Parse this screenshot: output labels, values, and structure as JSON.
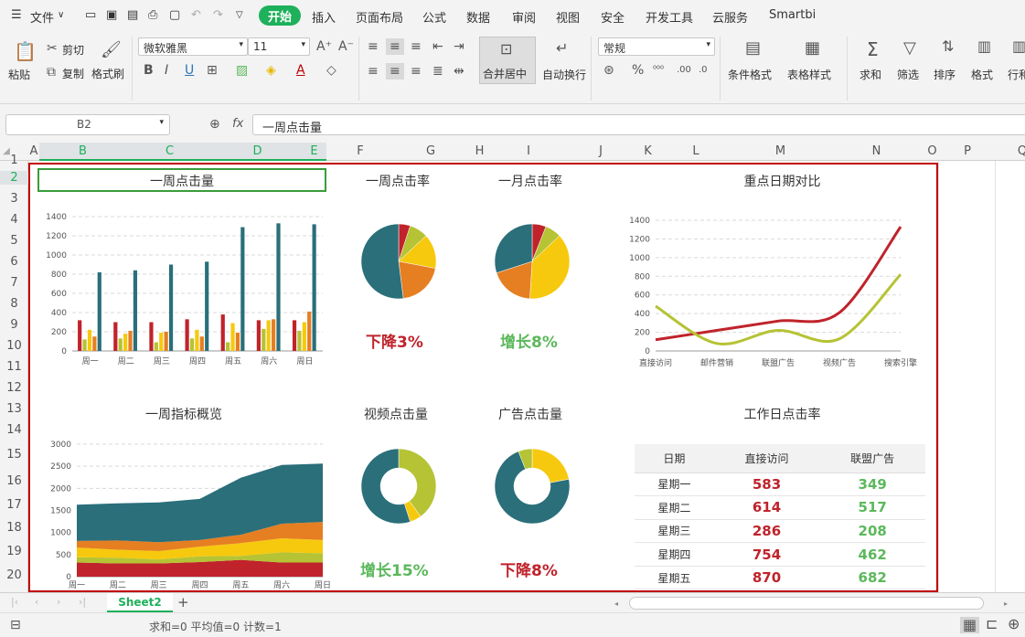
{
  "menu": {
    "file": "文件",
    "tabs": [
      "开始",
      "插入",
      "页面布局",
      "公式",
      "数据",
      "审阅",
      "视图",
      "安全",
      "开发工具",
      "云服务",
      "Smartbi"
    ]
  },
  "ribbon": {
    "paste": "粘贴",
    "cut": "剪切",
    "copy": "复制",
    "format_painter": "格式刷",
    "font_name": "微软雅黑",
    "font_size": "11",
    "merge_center": "合并居中",
    "wrap_text": "自动换行",
    "number_format": "常规",
    "conditional_format": "条件格式",
    "table_style": "表格样式",
    "sum": "求和",
    "filter": "筛选",
    "sort": "排序",
    "format": "格式",
    "row_col": "行和"
  },
  "formula_bar": {
    "name_box": "B2",
    "fx": "fx",
    "value": "一周点击量"
  },
  "columns": [
    "A",
    "B",
    "C",
    "D",
    "E",
    "F",
    "G",
    "H",
    "I",
    "J",
    "K",
    "L",
    "M",
    "N",
    "O",
    "P",
    "Q"
  ],
  "rows": [
    "1",
    "2",
    "3",
    "4",
    "5",
    "6",
    "7",
    "8",
    "9",
    "10",
    "11",
    "12",
    "13",
    "14",
    "15",
    "16",
    "17",
    "18",
    "19",
    "20"
  ],
  "dashboard": {
    "weekly_clicks_title": "一周点击量",
    "weekly_rate_title": "一周点击率",
    "monthly_rate_title": "一月点击率",
    "key_date_title": "重点日期对比",
    "weekly_overview_title": "一周指标概览",
    "video_clicks_title": "视频点击量",
    "ad_clicks_title": "广告点击量",
    "workday_rate_title": "工作日点击率",
    "weekly_rate_change": "下降3%",
    "monthly_rate_change": "增长8%",
    "video_change": "增长15%",
    "ad_change": "下降8%"
  },
  "workday_table": {
    "headers": [
      "日期",
      "直接访问",
      "联盟广告"
    ],
    "rows": [
      [
        "星期一",
        "583",
        "349"
      ],
      [
        "星期二",
        "614",
        "517"
      ],
      [
        "星期三",
        "286",
        "208"
      ],
      [
        "星期四",
        "754",
        "462"
      ],
      [
        "星期五",
        "870",
        "682"
      ]
    ]
  },
  "sheet_tab": "Sheet2",
  "status": "求和=0  平均值=0  计数=1",
  "colors": {
    "accent": "#1eb05a",
    "red": "#c0232b",
    "green": "#5cb85c",
    "teal": "#2a6f7a",
    "orange": "#e67e22",
    "yellow": "#f6c90e",
    "olive": "#b5c334",
    "blue": "#4472c4"
  },
  "chart_data": [
    {
      "type": "bar",
      "title": "一周点击量",
      "categories": [
        "周一",
        "周二",
        "周三",
        "周四",
        "周五",
        "周六",
        "周日"
      ],
      "ylim": [
        0,
        1400
      ],
      "yticks": [
        0,
        200,
        400,
        600,
        800,
        1000,
        1200,
        1400
      ],
      "series": [
        {
          "color": "#c0232b",
          "values": [
            320,
            300,
            300,
            330,
            380,
            320,
            320
          ]
        },
        {
          "color": "#b5c334",
          "values": [
            120,
            130,
            90,
            130,
            90,
            230,
            210
          ]
        },
        {
          "color": "#f6c90e",
          "values": [
            220,
            180,
            190,
            220,
            290,
            320,
            300
          ]
        },
        {
          "color": "#e67e22",
          "values": [
            150,
            210,
            200,
            150,
            190,
            330,
            410
          ]
        },
        {
          "color": "#2a6f7a",
          "values": [
            820,
            840,
            900,
            930,
            1290,
            1330,
            1320
          ]
        }
      ]
    },
    {
      "type": "pie",
      "title": "一周点击率",
      "values": [
        5,
        8,
        15,
        20,
        52
      ],
      "colors": [
        "#c0232b",
        "#b5c334",
        "#f6c90e",
        "#e67e22",
        "#2a6f7a"
      ]
    },
    {
      "type": "pie",
      "title": "一月点击率",
      "values": [
        6,
        7,
        38,
        19,
        30
      ],
      "colors": [
        "#c0232b",
        "#b5c334",
        "#f6c90e",
        "#e67e22",
        "#2a6f7a"
      ]
    },
    {
      "type": "line",
      "title": "重点日期对比",
      "categories": [
        "直接访问",
        "邮件营销",
        "联盟广告",
        "视频广告",
        "搜索引擎"
      ],
      "ylim": [
        0,
        1400
      ],
      "yticks": [
        0,
        200,
        400,
        600,
        800,
        1000,
        1200,
        1400
      ],
      "series": [
        {
          "color": "#c0232b",
          "values": [
            120,
            220,
            320,
            410,
            1330
          ]
        },
        {
          "color": "#b5c334",
          "values": [
            480,
            80,
            220,
            130,
            820
          ]
        }
      ]
    },
    {
      "type": "area",
      "title": "一周指标概览",
      "categories": [
        "周一",
        "周二",
        "周三",
        "周四",
        "周五",
        "周六",
        "周日"
      ],
      "ylim": [
        0,
        3000
      ],
      "yticks": [
        0,
        500,
        1000,
        1500,
        2000,
        2500,
        3000
      ],
      "series": [
        {
          "color": "#c0232b",
          "values": [
            320,
            300,
            300,
            330,
            380,
            320,
            320
          ]
        },
        {
          "color": "#b5c334",
          "values": [
            120,
            130,
            90,
            130,
            90,
            230,
            210
          ]
        },
        {
          "color": "#f6c90e",
          "values": [
            220,
            180,
            190,
            220,
            290,
            320,
            300
          ]
        },
        {
          "color": "#e67e22",
          "values": [
            150,
            210,
            200,
            150,
            190,
            330,
            410
          ]
        },
        {
          "color": "#2a6f7a",
          "values": [
            820,
            840,
            900,
            930,
            1290,
            1330,
            1320
          ]
        }
      ]
    },
    {
      "type": "pie",
      "title": "视频点击量",
      "values": [
        40,
        5,
        55
      ],
      "colors": [
        "#b5c334",
        "#f6c90e",
        "#2a6f7a"
      ]
    },
    {
      "type": "pie",
      "title": "广告点击量",
      "values": [
        22,
        72,
        6
      ],
      "colors": [
        "#f6c90e",
        "#2a6f7a",
        "#b5c334"
      ]
    }
  ]
}
